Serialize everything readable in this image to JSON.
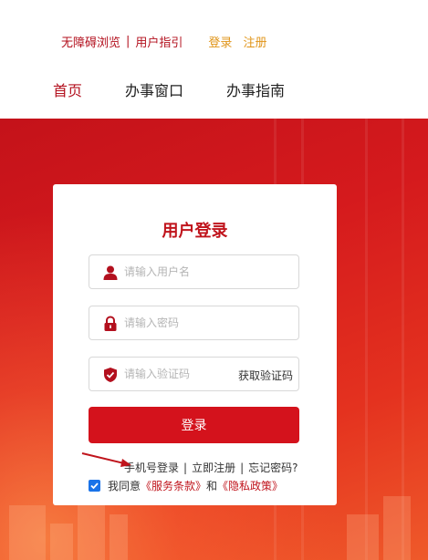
{
  "header": {
    "top_links": {
      "accessibility": "无障碍浏览",
      "separator": "|",
      "user_guide": "用户指引",
      "login": "登录",
      "register": "注册"
    },
    "nav": [
      "首页",
      "办事窗口",
      "办事指南"
    ]
  },
  "login_card": {
    "title": "用户登录",
    "username_placeholder": "请输入用户名",
    "password_placeholder": "请输入密码",
    "captcha_placeholder": "请输入验证码",
    "get_code": "获取验证码",
    "submit": "登录",
    "links": {
      "phone_login": "手机号登录",
      "separator": "|",
      "register_now": "立即注册",
      "forgot_password": "忘记密码?"
    },
    "agreement": {
      "checked": true,
      "prefix": "我同意",
      "terms": "《服务条款》",
      "and": "和",
      "privacy": "《隐私政策》"
    }
  },
  "colors": {
    "brand_red": "#c0141c",
    "button_red": "#d4121c",
    "auth_orange": "#e09418",
    "checkbox_blue": "#1a73e8"
  }
}
